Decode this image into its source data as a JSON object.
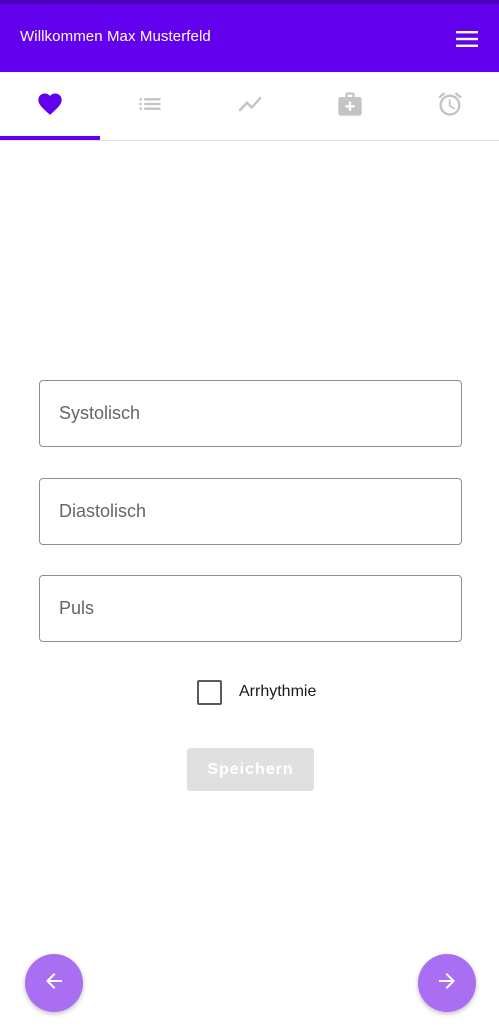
{
  "appbar": {
    "title": "Willkommen Max Musterfeld",
    "menu_icon": "hamburger-menu-icon",
    "color": "#6200ee"
  },
  "tabs": [
    {
      "icon": "heart-icon",
      "active": true
    },
    {
      "icon": "list-icon",
      "active": false
    },
    {
      "icon": "trending-chart-icon",
      "active": false
    },
    {
      "icon": "medical-kit-icon",
      "active": false
    },
    {
      "icon": "alarm-clock-icon",
      "active": false
    }
  ],
  "form": {
    "systolic_placeholder": "Systolisch",
    "diastolic_placeholder": "Diastolisch",
    "pulse_placeholder": "Puls",
    "arrhythmia_label": "Arrhythmie",
    "arrhythmia_checked": false,
    "save_label": "Speichern",
    "save_enabled": false
  },
  "nav": {
    "back_icon": "arrow-left-icon",
    "forward_icon": "arrow-right-icon",
    "fab_color": "#a96ef1"
  }
}
